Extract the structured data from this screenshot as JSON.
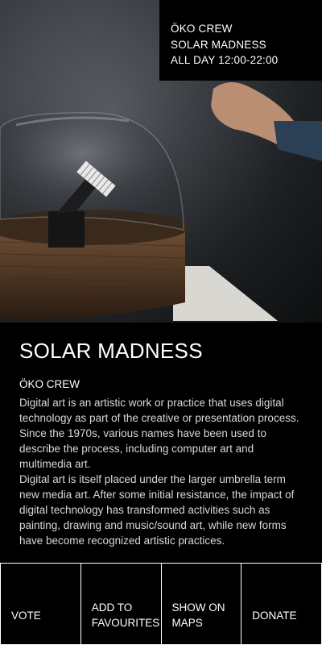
{
  "event": {
    "artist": "ÖKO CREW",
    "title": "SOLAR MADNESS",
    "schedule": "ALL DAY  12:00-22:00"
  },
  "content": {
    "title": "SOLAR MADNESS",
    "artist": "ÖKO CREW",
    "paragraphs": [
      "Digital art is an artistic work or practice that uses digital technology as part of the creative or presentation process. Since the 1970s, various names have been used to describe the process, including computer art and multimedia art.",
      "Digital art is itself placed under the larger umbrella term new media art. After some initial resistance, the impact of digital technology has transformed activities such as painting, drawing and music/sound art, while new forms have become recognized artistic practices."
    ]
  },
  "actions": {
    "vote": "VOTE",
    "favourites_line1": "ADD TO",
    "favourites_line2": "FAVOURITES",
    "maps_line1": "SHOW ON",
    "maps_line2": "MAPS",
    "donate": "DONATE"
  },
  "colors": {
    "background": "#000000",
    "text": "#ffffff"
  }
}
